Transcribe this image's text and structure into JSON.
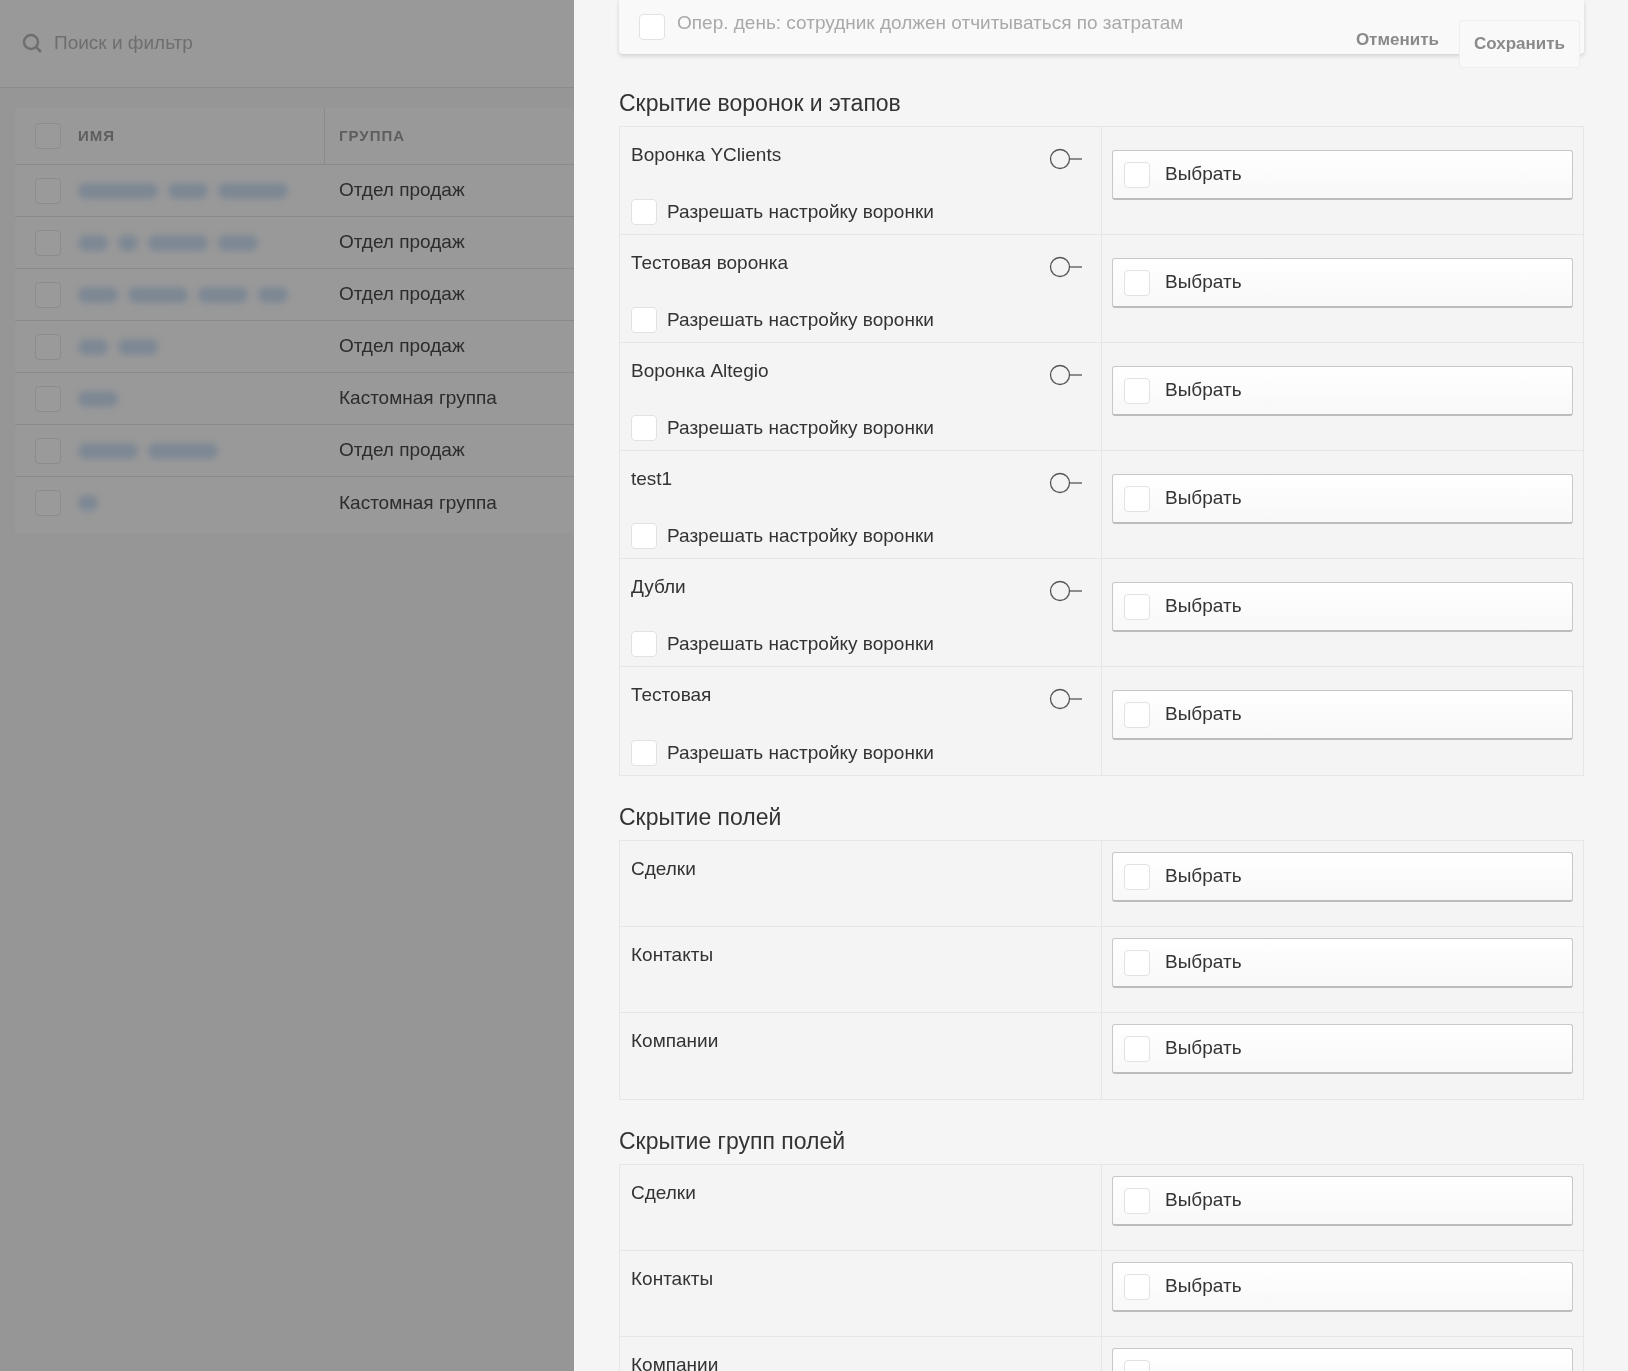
{
  "list_panel": {
    "search": {
      "placeholder": "Поиск и фильтр"
    },
    "table": {
      "header_checked": false,
      "columns": [
        "ИМЯ",
        "ГРУППА"
      ],
      "rows": [
        {
          "checked": false,
          "group": "Отдел продаж"
        },
        {
          "checked": false,
          "group": "Отдел продаж"
        },
        {
          "checked": false,
          "group": "Отдел продаж"
        },
        {
          "checked": false,
          "group": "Отдел продаж"
        },
        {
          "checked": false,
          "group": "Кастомная группа"
        },
        {
          "checked": false,
          "group": "Отдел продаж"
        },
        {
          "checked": false,
          "group": "Кастомная группа"
        }
      ]
    }
  },
  "settings_panel": {
    "top_card": {
      "option": {
        "label": "Опер. день: сотрудник должен отчитываться по затратам",
        "checked": false
      },
      "buttons": [
        "Отменить",
        "Сохранить"
      ]
    },
    "sections": [
      {
        "title": "Скрытие воронок и этапов",
        "rows": [
          {
            "kind": "funnel",
            "name": "Воронка YClients",
            "enabled": false,
            "allow_setup": {
              "label": "Разрешать настройку воронки",
              "checked": false
            },
            "select": {
              "label": "Выбрать",
              "checked": false
            }
          },
          {
            "kind": "funnel",
            "name": "Тестовая воронка",
            "enabled": false,
            "allow_setup": {
              "label": "Разрешать настройку воронки",
              "checked": false
            },
            "select": {
              "label": "Выбрать",
              "checked": false
            }
          },
          {
            "kind": "funnel",
            "name": "Воронка Altegio",
            "enabled": false,
            "allow_setup": {
              "label": "Разрешать настройку воронки",
              "checked": false
            },
            "select": {
              "label": "Выбрать",
              "checked": false
            }
          },
          {
            "kind": "funnel",
            "name": "test1",
            "enabled": false,
            "allow_setup": {
              "label": "Разрешать настройку воронки",
              "checked": false
            },
            "select": {
              "label": "Выбрать",
              "checked": false
            }
          },
          {
            "kind": "funnel",
            "name": "Дубли",
            "enabled": false,
            "allow_setup": {
              "label": "Разрешать настройку воронки",
              "checked": false
            },
            "select": {
              "label": "Выбрать",
              "checked": false
            }
          },
          {
            "kind": "funnel",
            "name": "Тестовая",
            "enabled": false,
            "allow_setup": {
              "label": "Разрешать настройку воронки",
              "checked": false
            },
            "select": {
              "label": "Выбрать",
              "checked": false
            }
          }
        ]
      },
      {
        "title": "Скрытие полей",
        "rows": [
          {
            "kind": "entity",
            "name": "Сделки",
            "select": {
              "label": "Выбрать",
              "checked": false
            }
          },
          {
            "kind": "entity",
            "name": "Контакты",
            "select": {
              "label": "Выбрать",
              "checked": false
            }
          },
          {
            "kind": "entity",
            "name": "Компании",
            "select": {
              "label": "Выбрать",
              "checked": false
            }
          }
        ]
      },
      {
        "title": "Скрытие групп полей",
        "rows": [
          {
            "kind": "entity",
            "name": "Сделки",
            "select": {
              "label": "Выбрать",
              "checked": false
            }
          },
          {
            "kind": "entity",
            "name": "Контакты",
            "select": {
              "label": "Выбрать",
              "checked": false
            }
          },
          {
            "kind": "entity",
            "name": "Компании",
            "select": {
              "checked": false
            }
          }
        ]
      }
    ]
  }
}
